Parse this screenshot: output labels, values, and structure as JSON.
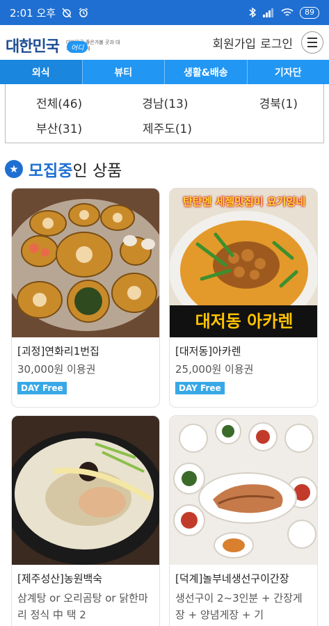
{
  "status_bar": {
    "time": "2:01 오후",
    "battery": "89"
  },
  "header": {
    "logo_text": "대한민국",
    "logo_badge": "어디",
    "logo_sub": "대한민국 좋은가볼 곳과 대표 좋은가게",
    "signup": "회원가입",
    "login": "로그인"
  },
  "tabs": [
    {
      "label": "외식",
      "active": true
    },
    {
      "label": "뷰티",
      "active": false
    },
    {
      "label": "생활&배송",
      "active": false
    },
    {
      "label": "기자단",
      "active": false
    }
  ],
  "regions": [
    [
      "전체(46)",
      "경남(13)",
      "경북(1)"
    ],
    [
      "부산(31)",
      "제주도(1)"
    ]
  ],
  "section": {
    "title_strong": "모집중",
    "title_rest": "인 상품"
  },
  "cards": [
    {
      "name": "[괴정]연화리1번집",
      "price": "30,000원 이용권",
      "badge": "DAY Free"
    },
    {
      "name": "[대저동]아카렌",
      "price": "25,000원 이용권",
      "badge": "DAY Free",
      "overlay_top": "탄탄멘 세젤맛집이 요기잉네",
      "overlay_bottom": "대저동 아카렌"
    },
    {
      "name": "[제주성산]농원백숙",
      "desc": "삼계탕 or 오리곰탕 or 닭한마리 정식 中 택 2"
    },
    {
      "name": "[덕계]놀부네생선구이간장",
      "desc": "생선구이 2~3인분 + 간장게장 + 양념게장 + 기"
    }
  ],
  "colors": {
    "primary": "#1f6fd2",
    "tab_bg": "#2196f3",
    "badge": "#39a8e6"
  }
}
